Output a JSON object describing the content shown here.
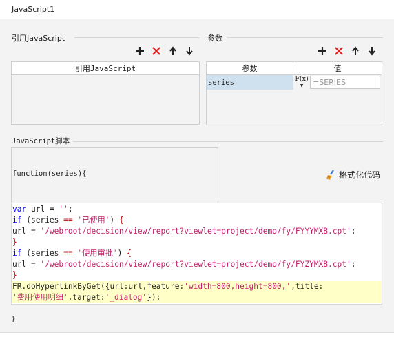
{
  "window": {
    "title": "JavaScript1"
  },
  "referenced_js": {
    "section_title": "引用JavaScript",
    "column_header": "引用JavaScript",
    "rows": []
  },
  "params": {
    "section_title": "参数",
    "columns": [
      "参数",
      "值"
    ],
    "rows": [
      {
        "name": "series",
        "formula_icon": "F(x)",
        "value": "=SERIES"
      }
    ]
  },
  "script": {
    "section_title": "JavaScript脚本",
    "function_signature": "function(series){",
    "format_button_label": "格式化代码",
    "closing_brace": "}",
    "lines": [
      [
        [
          "kw",
          "var"
        ],
        [
          "p",
          " url = "
        ],
        [
          "str",
          "''"
        ],
        [
          "p",
          ";"
        ]
      ],
      [
        [
          "kw",
          "if"
        ],
        [
          "p",
          " (series "
        ],
        [
          "op",
          "=="
        ],
        [
          "p",
          " "
        ],
        [
          "str",
          "'已使用'"
        ],
        [
          "p",
          ") "
        ],
        [
          "br",
          "{"
        ]
      ],
      [
        [
          "p",
          "url = "
        ],
        [
          "str",
          "'/webroot/decision/view/report?viewlet=project/demo/fy/FYYYMXB.cpt'"
        ],
        [
          "p",
          ";"
        ]
      ],
      [
        [
          "br",
          "}"
        ]
      ],
      [
        [
          "kw",
          "if"
        ],
        [
          "p",
          " (series "
        ],
        [
          "op",
          "=="
        ],
        [
          "p",
          " "
        ],
        [
          "str",
          "'使用审批'"
        ],
        [
          "p",
          ") "
        ],
        [
          "br",
          "{"
        ]
      ],
      [
        [
          "p",
          "url = "
        ],
        [
          "str",
          "'/webroot/decision/view/report?viewlet=project/demo/fy/FYZYMXB.cpt'"
        ],
        [
          "p",
          ";"
        ]
      ],
      [
        [
          "br",
          "}"
        ]
      ],
      [
        [
          "p",
          "FR.doHyperlinkByGet({url:url,feature:"
        ],
        [
          "str",
          "'width=800,height=800,'"
        ],
        [
          "p",
          ",title:"
        ]
      ],
      [
        [
          "str",
          "'费用使用明细'"
        ],
        [
          "p",
          ",target:"
        ],
        [
          "str",
          "'_dialog'"
        ],
        [
          "p",
          "});"
        ]
      ]
    ],
    "highlighted_lines": [
      7,
      8
    ]
  },
  "toolbar_icons": [
    "add-icon",
    "delete-icon",
    "move-up-icon",
    "move-down-icon"
  ],
  "colors": {
    "keyword": "#0000ff",
    "string": "#c0206a",
    "brace": "#cc0000",
    "selected_row": "#cfe0ee",
    "delete": "#e02020"
  }
}
